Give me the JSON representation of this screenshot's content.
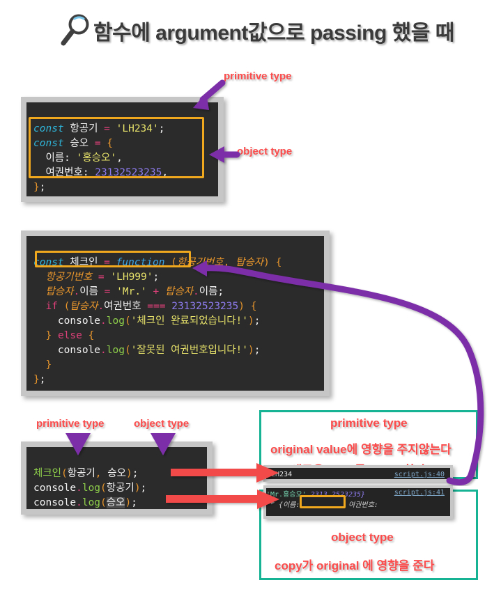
{
  "page": {
    "title": "함수에 argument값으로 passing 했을 때",
    "magnifier_icon": "magnifier-icon",
    "background": "#ffffff"
  },
  "colors": {
    "code_bg": "#2b2b2b",
    "frame": "#c6c6c6",
    "highlight_border": "#f0a81e",
    "sticker_text": "#fb4b4b",
    "teal_border": "#16b494",
    "purple_arrow": "#7b2fa8",
    "red_arrow": "#f24a4a"
  },
  "code_block_1": {
    "lines": [
      {
        "tokens": [
          {
            "t": "const",
            "c": "kw"
          },
          {
            "t": " ",
            "c": "plain"
          },
          {
            "t": "항공기",
            "c": "white"
          },
          {
            "t": " ",
            "c": "plain"
          },
          {
            "t": "=",
            "c": "op"
          },
          {
            "t": " ",
            "c": "plain"
          },
          {
            "t": "'LH234'",
            "c": "str"
          },
          {
            "t": ";",
            "c": "white"
          }
        ]
      },
      {
        "tokens": [
          {
            "t": "const",
            "c": "kw"
          },
          {
            "t": " ",
            "c": "plain"
          },
          {
            "t": "승오",
            "c": "white"
          },
          {
            "t": " ",
            "c": "plain"
          },
          {
            "t": "=",
            "c": "op"
          },
          {
            "t": " ",
            "c": "plain"
          },
          {
            "t": "{",
            "c": "punct"
          }
        ]
      },
      {
        "tokens": [
          {
            "t": "  이름",
            "c": "white"
          },
          {
            "t": ": ",
            "c": "white"
          },
          {
            "t": "'홍승오'",
            "c": "str"
          },
          {
            "t": ",",
            "c": "white"
          }
        ]
      },
      {
        "tokens": [
          {
            "t": "  여권번호",
            "c": "white"
          },
          {
            "t": ": ",
            "c": "white"
          },
          {
            "t": "23132523235",
            "c": "num"
          },
          {
            "t": ",",
            "c": "white"
          }
        ]
      },
      {
        "tokens": [
          {
            "t": "}",
            "c": "punct"
          },
          {
            "t": ";",
            "c": "white"
          }
        ]
      }
    ],
    "text": [
      "const 항공기 = 'LH234';",
      "const 승오 = {",
      "  이름: '홍승오',",
      "  여권번호: 23132523235,",
      "};"
    ]
  },
  "code_block_2": {
    "text": [
      "const 체크인 = function (항공기번호, 탑승자) {",
      "  항공기번호 = 'LH999';",
      "  탑승자.이름 = 'Mr.' + 탑승자.이름;",
      "  if (탑승자.여권번호 === 23132523235) {",
      "    console.log('체크인 완료되었습니다!');",
      "  } else {",
      "    console.log('잘못된 여권번호입니다!');",
      "  }",
      "};"
    ]
  },
  "code_block_3": {
    "text": [
      "체크인(항공기, 승오);",
      "console.log(항공기);",
      "console.log(승오);"
    ]
  },
  "annotations": {
    "primitive_type_top": "primitive type",
    "object_type_top": "object type",
    "primitive_type_bottom_left": "primitive type",
    "object_type_bottom_left": "object type",
    "primitive_type_teal": "primitive type",
    "primitive_note_line1": "original value에 영향을 주지않는다",
    "primitive_note_line2": "(새로운 copy를 create한다)",
    "object_type_teal": "object type",
    "object_note_line1": "copy가 original 에 영향을 준다"
  },
  "console": {
    "row1": {
      "value": "LH234",
      "source": "script.js:40"
    },
    "row2": {
      "source": "script.js:41",
      "obj_open": "{이름:",
      "obj_name_value": "'Mr.홍승오'",
      "obj_comma": ",",
      "obj_key2": "여권번호:",
      "obj_num_part1": "2313",
      "obj_num_part2": "2523235}",
      "expand_triangle": "▶"
    }
  }
}
